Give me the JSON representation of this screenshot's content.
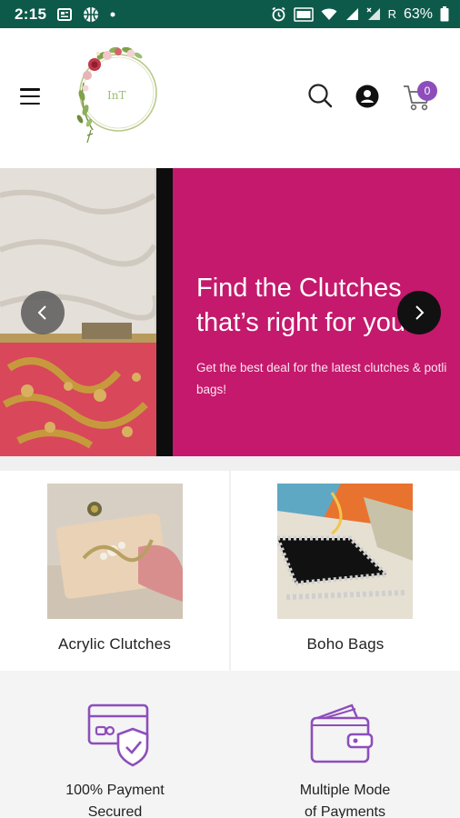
{
  "status_bar": {
    "time": "2:15",
    "battery": "63%",
    "roaming": "R"
  },
  "header": {
    "logo_text": "InT",
    "cart_count": "0"
  },
  "hero": {
    "title_line1": "Find the Clutches",
    "title_line2": "that’s right for you",
    "subtitle": "Get the best deal for the latest clutches & potli bags!"
  },
  "categories": [
    {
      "label": "Acrylic Clutches"
    },
    {
      "label": "Boho Bags"
    }
  ],
  "features": [
    {
      "line1": "100% Payment",
      "line2": "Secured"
    },
    {
      "line1": "Multiple Mode",
      "line2": "of Payments"
    }
  ],
  "colors": {
    "status_bar": "#0e5a4a",
    "hero_pink": "#c4196c",
    "accent_purple": "#8d4ebb"
  }
}
